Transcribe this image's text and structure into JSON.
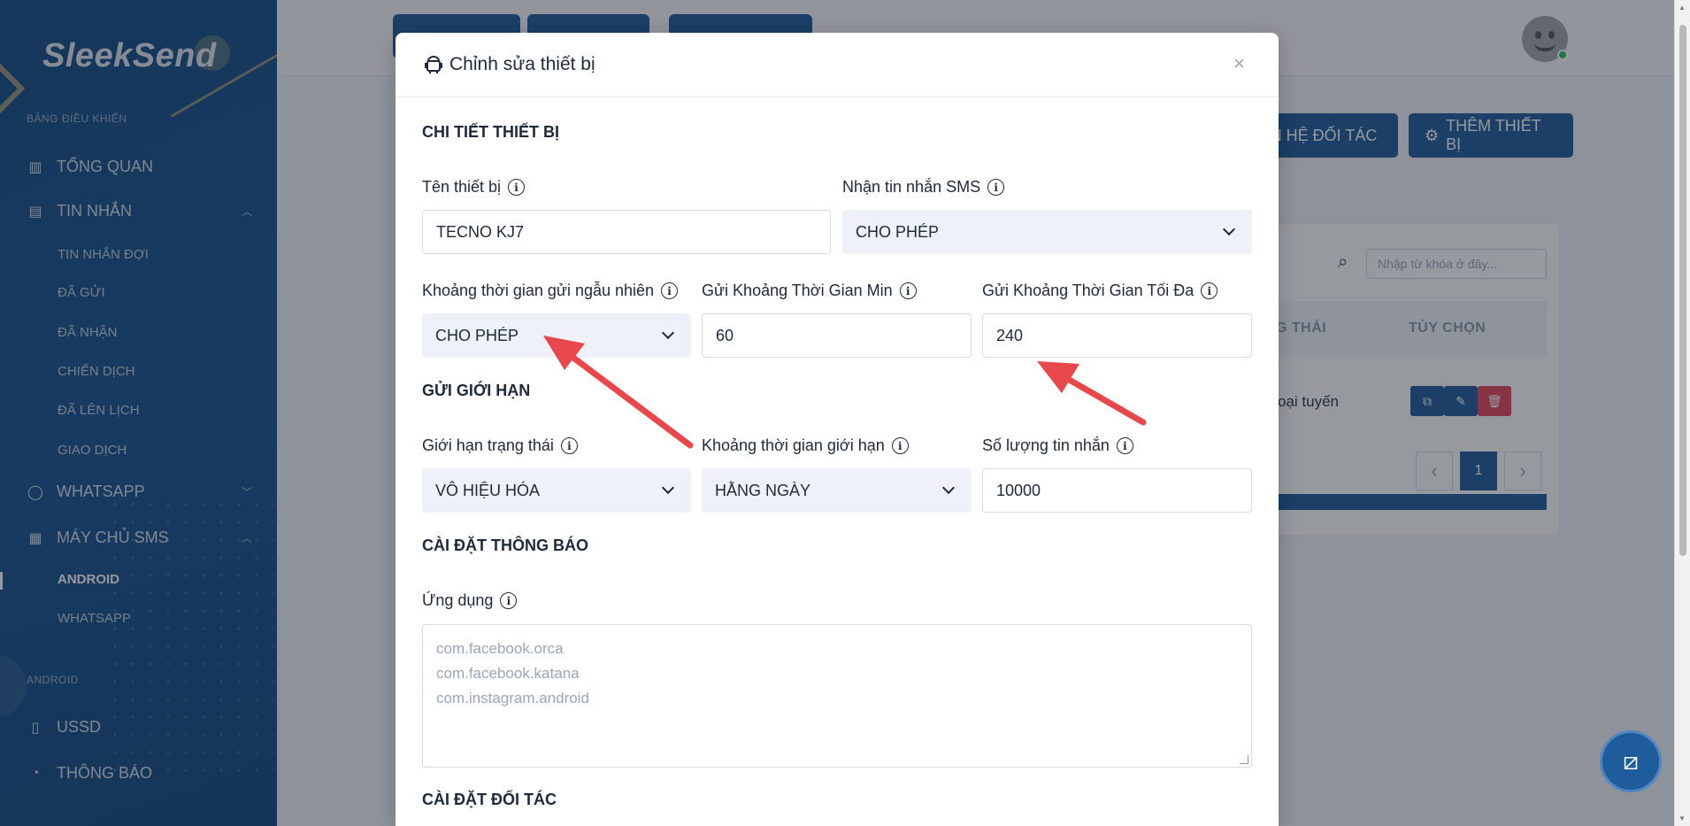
{
  "sidebar": {
    "logo": "SleekSend",
    "section_dashboard": "BẢNG ĐIỀU KHIỂN",
    "item_overview": "TỔNG QUAN",
    "item_messages": "TIN NHẮN",
    "sub_queued": "TIN NHẮN ĐỢI",
    "sub_sent": "ĐÃ GỬI",
    "sub_received": "ĐÃ NHẬN",
    "sub_campaigns": "CHIẾN DỊCH",
    "sub_scheduled": "ĐÃ LÊN LỊCH",
    "sub_transactions": "GIAO DỊCH",
    "item_whatsapp": "WHATSAPP",
    "item_sms_server": "MÁY CHỦ SMS",
    "sub_android": "ANDROID",
    "sub_whatsapp": "WHATSAPP",
    "section_android": "ANDROID",
    "item_ussd": "USSD",
    "item_notifications": "THÔNG BÁO"
  },
  "background": {
    "btn_partner": "AN HỆ ĐỐI TÁC",
    "btn_add_device": "THÊM THIẾT BỊ",
    "search_placeholder": "Nhập từ khóa ở đây...",
    "th_status": "G THÁI",
    "th_options": "TÙY CHỌN",
    "cell_status": "oại tuyến",
    "page": "1"
  },
  "modal": {
    "title": "Chỉnh sửa thiết bị",
    "close": "×",
    "section_details": "CHI TIẾT THIẾT BỊ",
    "label_device_name": "Tên thiết bị",
    "value_device_name": "TECNO KJ7",
    "label_receive_sms": "Nhận tin nhắn SMS",
    "value_receive_sms": "CHO PHÉP",
    "label_random_interval": "Khoảng thời gian gửi ngẫu nhiên",
    "value_random_interval": "CHO PHÉP",
    "label_min_interval": "Gửi Khoảng Thời Gian Min",
    "value_min_interval": "60",
    "label_max_interval": "Gửi Khoảng Thời Gian Tối Đa",
    "value_max_interval": "240",
    "section_limit": "GỬI GIỚI HẠN",
    "label_limit_status": "Giới hạn trạng thái",
    "value_limit_status": "VÔ HIỆU HÓA",
    "label_limit_interval": "Khoảng thời gian giới hạn",
    "value_limit_interval": "HẰNG NGÀY",
    "label_message_count": "Số lượng tin nhắn",
    "value_message_count": "10000",
    "section_notifications": "CÀI ĐẶT THÔNG BÁO",
    "label_apps": "Ứng dụng",
    "apps_placeholder_1": "com.facebook.orca",
    "apps_placeholder_2": "com.facebook.katana",
    "apps_placeholder_3": "com.instagram.android",
    "section_partner": "CÀI ĐẶT ĐỐI TÁC"
  },
  "colors": {
    "primary": "#1f5c9c",
    "arrow": "#e8474b",
    "danger": "#e0455e"
  }
}
